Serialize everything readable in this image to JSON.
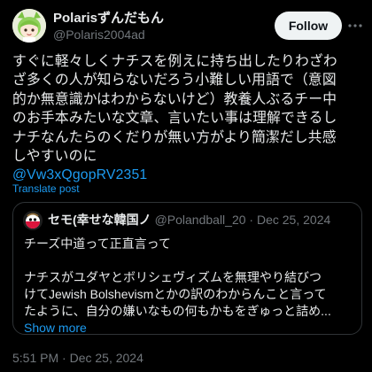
{
  "author": {
    "display_name": "Polarisずんだもん",
    "handle": "@Polaris2004ad"
  },
  "follow_label": "Follow",
  "more_icon": "more-horizontal-icon",
  "tweet": {
    "lines": [
      "すぐに軽々しくナチスを例えに持ち出したりわざわ",
      "ざ多くの人が知らないだろう小難しい用語で（意図",
      "的か無意識かはわからないけど）教養人ぶるチー中",
      "のお手本みたいな文章、言いたい事は理解できるし",
      "ナチなんたらのくだりが無い方がより簡潔だし共感",
      "しやすいのに"
    ],
    "mention": "@Vw3xQgopRV2351"
  },
  "translate_label": "Translate post",
  "quote": {
    "name": "セモ(幸せな韓国ノ",
    "handle": "@Polandball_20",
    "separator": "·",
    "date": "Dec 25, 2024",
    "lines": [
      "チーズ中道って正直言って",
      "",
      "ナチスがユダヤとボリシェヴィズムを無理やり結びつ",
      "けてJewish Bolshevismとかの訳のわからんこと言って",
      "たように、自分の嫌いなもの何もかもをぎゅっと詰め..."
    ],
    "show_more": "Show more"
  },
  "timestamp": {
    "time": "5:51 PM",
    "separator": "·",
    "date": "Dec 25, 2024"
  }
}
